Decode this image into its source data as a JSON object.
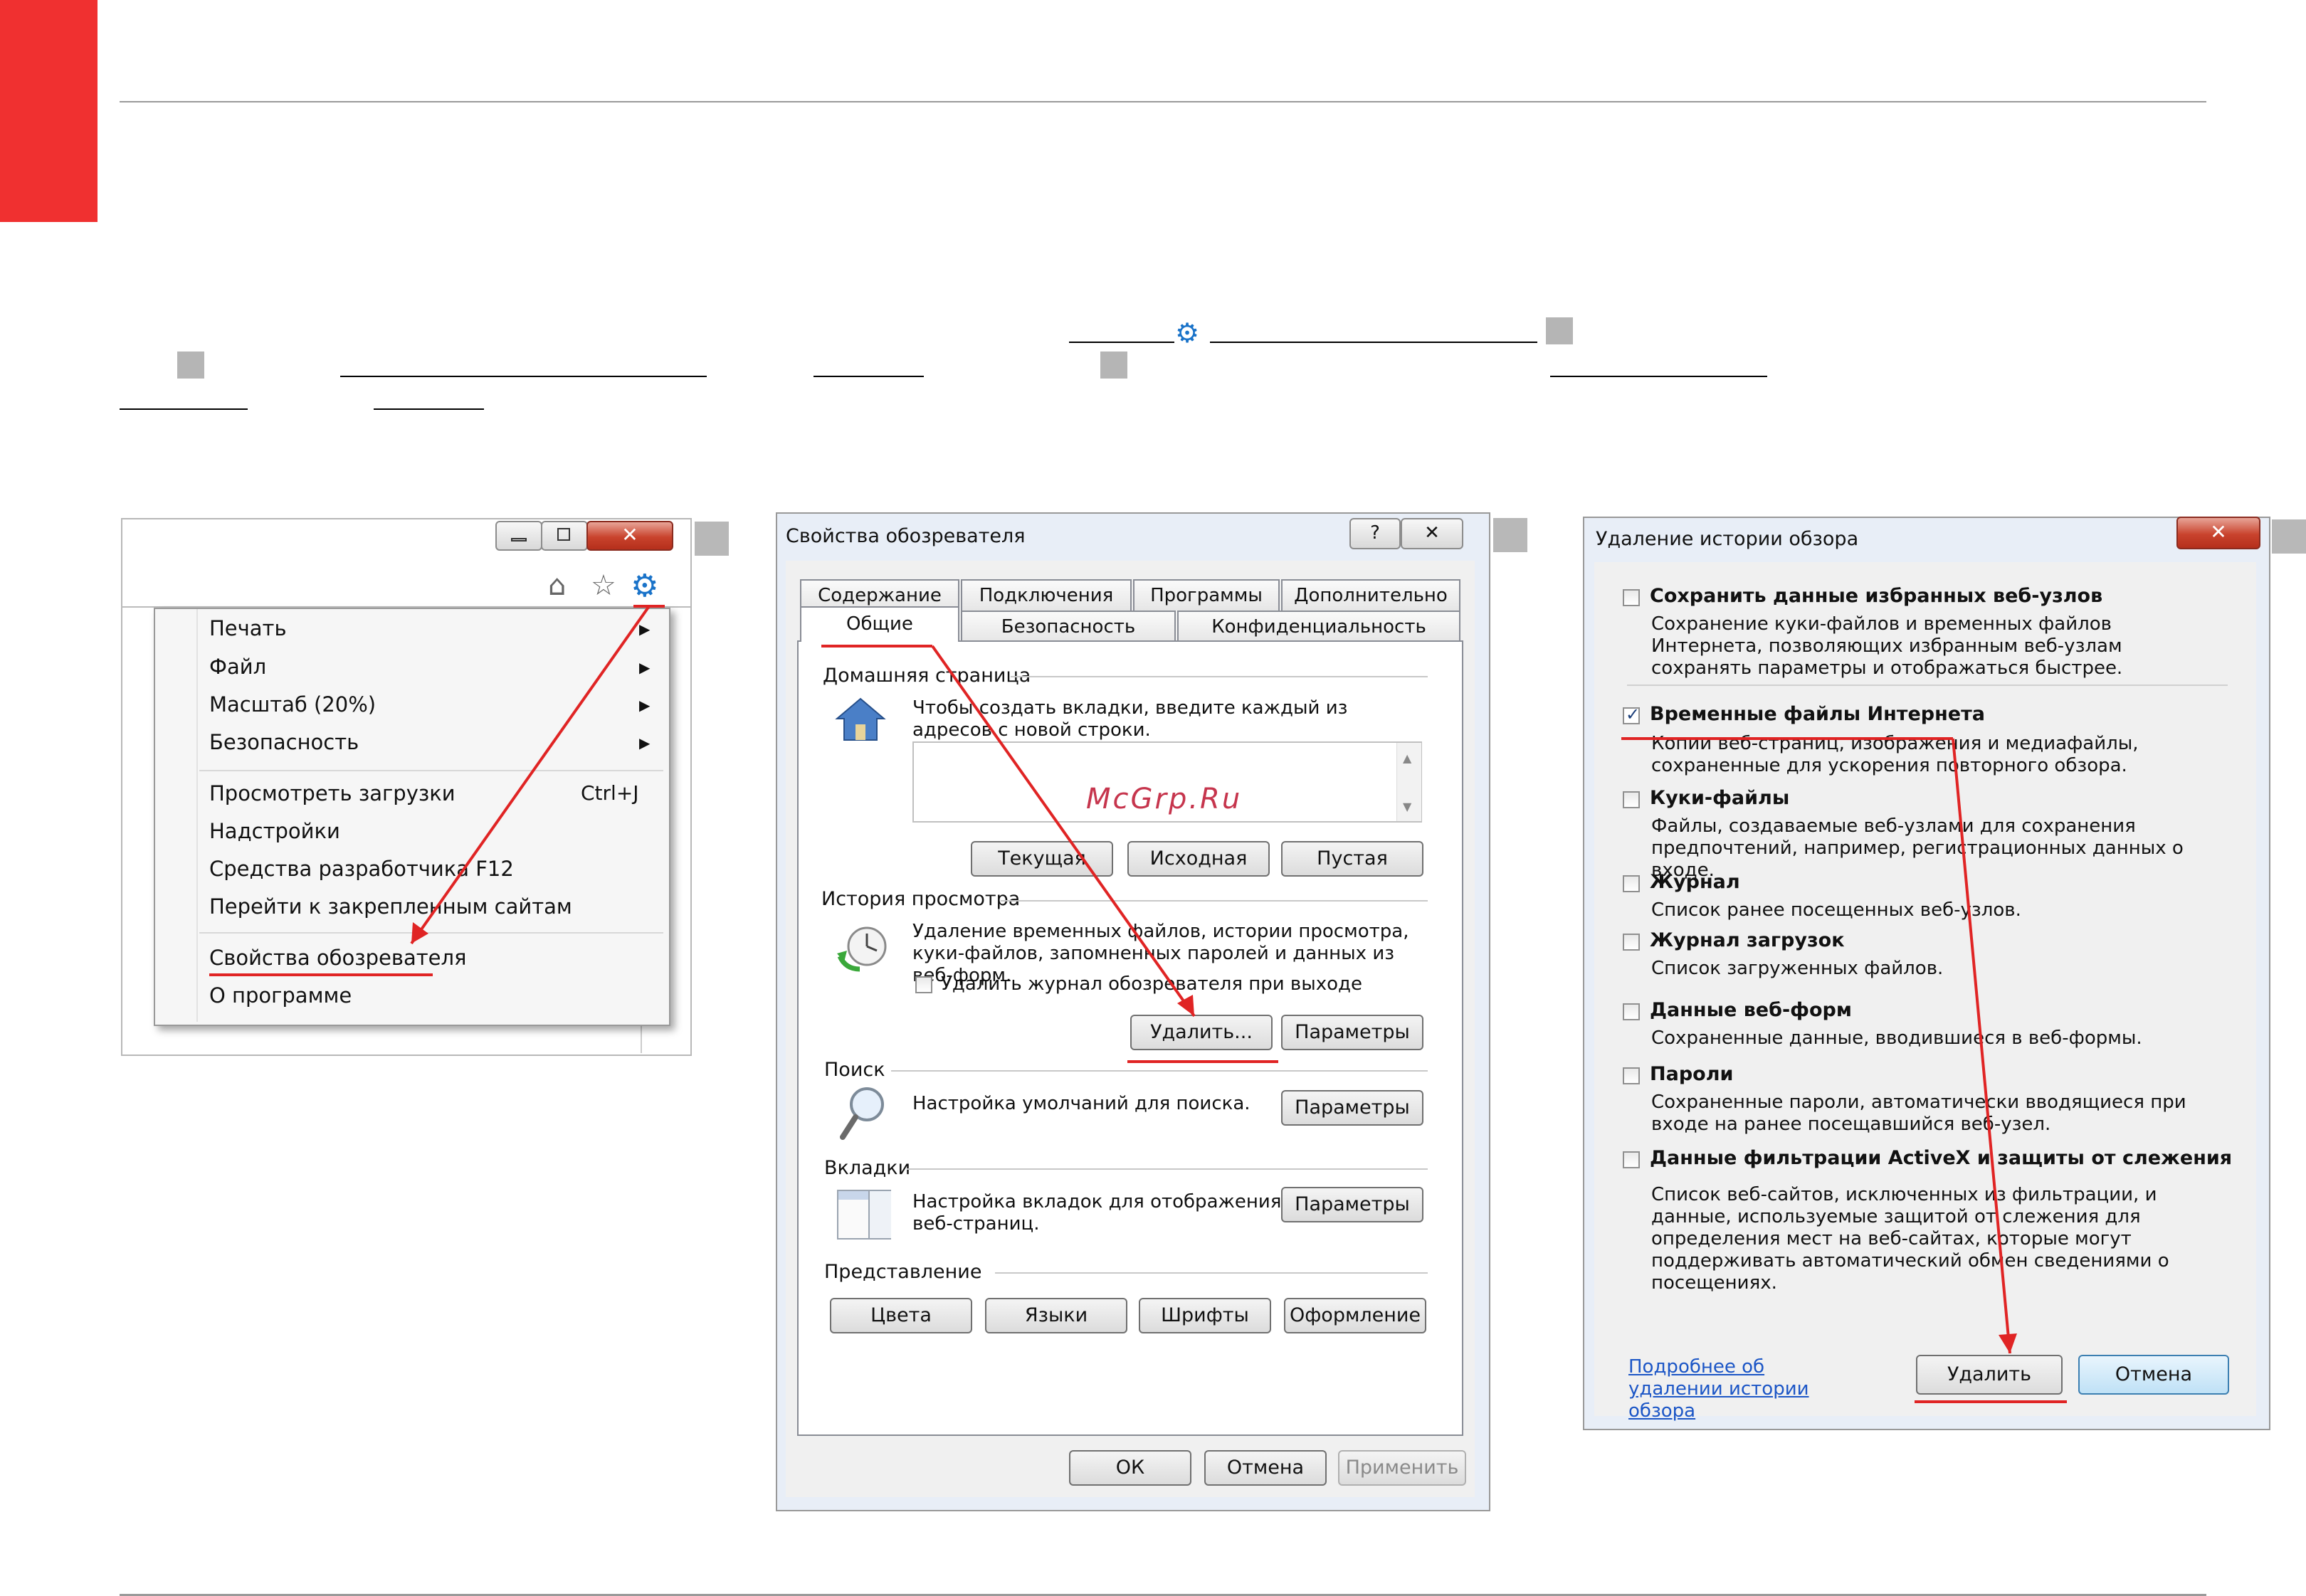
{
  "panel1": {
    "menu": {
      "items": [
        {
          "label": "Печать",
          "submenu": true
        },
        {
          "label": "Файл",
          "submenu": true
        },
        {
          "label": "Масштаб (20%)",
          "submenu": true
        },
        {
          "label": "Безопасность",
          "submenu": true
        },
        {
          "label": "Просмотреть загрузки",
          "shortcut": "Ctrl+J"
        },
        {
          "label": "Надстройки"
        },
        {
          "label": "Средства разработчика F12"
        },
        {
          "label": "Перейти к закрепленным сайтам"
        },
        {
          "label": "Свойства обозревателя"
        },
        {
          "label": "О программе"
        }
      ]
    },
    "icons": [
      "home-icon",
      "star-icon",
      "gear-icon"
    ]
  },
  "panel2": {
    "title": "Свойства обозревателя",
    "help": "?",
    "tabs_row1": [
      "Содержание",
      "Подключения",
      "Программы",
      "Дополнительно"
    ],
    "tabs_row2": [
      "Общие",
      "Безопасность",
      "Конфиденциальность"
    ],
    "home": {
      "label": "Домашняя страница",
      "text": "Чтобы создать вкладки, введите каждый из адресов с новой строки.",
      "btn_current": "Текущая",
      "btn_default": "Исходная",
      "btn_blank": "Пустая"
    },
    "watermark": "McGrp.Ru",
    "history": {
      "label": "История просмотра",
      "text": "Удаление временных файлов, истории просмотра, куки-файлов, запомненных паролей и данных из веб-форм.",
      "checkbox": "Удалить журнал обозревателя при выходе",
      "btn_delete": "Удалить...",
      "btn_params": "Параметры"
    },
    "search": {
      "label": "Поиск",
      "text": "Настройка умолчаний для поиска.",
      "btn": "Параметры"
    },
    "tabs_section": {
      "label": "Вкладки",
      "text": "Настройка вкладок для отображения веб-страниц.",
      "btn": "Параметры"
    },
    "appearance": {
      "label": "Представление",
      "btns": [
        "Цвета",
        "Языки",
        "Шрифты",
        "Оформление"
      ]
    },
    "footer": {
      "ok": "ОК",
      "cancel": "Отмена",
      "apply": "Применить"
    }
  },
  "panel3": {
    "title": "Удаление истории обзора",
    "items": [
      {
        "title": "Сохранить данные избранных веб-узлов",
        "desc": "Сохранение куки-файлов и временных файлов Интернета, позволяющих избранным веб-узлам сохранять параметры и отображаться быстрее.",
        "checked": false
      },
      {
        "title": "Временные файлы Интернета",
        "desc": "Копии веб-страниц, изображения и медиафайлы, сохраненные для ускорения повторного обзора.",
        "checked": true
      },
      {
        "title": "Куки-файлы",
        "desc": "Файлы, создаваемые веб-узлами для сохранения предпочтений, например, регистрационных данных о входе.",
        "checked": false
      },
      {
        "title": "Журнал",
        "desc": "Список ранее посещенных веб-узлов.",
        "checked": false
      },
      {
        "title": "Журнал загрузок",
        "desc": "Список загруженных файлов.",
        "checked": false
      },
      {
        "title": "Данные веб-форм",
        "desc": "Сохраненные данные, вводившиеся в веб-формы.",
        "checked": false
      },
      {
        "title": "Пароли",
        "desc": "Сохраненные пароли, автоматически вводящиеся при входе на ранее посещавшийся веб-узел.",
        "checked": false
      },
      {
        "title": "Данные фильтрации ActiveX и защиты от слежения",
        "desc": "Список веб-сайтов, исключенных из фильтрации, и данные, используемые защитой от слежения для определения мест на веб-сайтах, которые могут поддерживать автоматический обмен сведениями о посещениях.",
        "checked": false
      }
    ],
    "link": "Подробнее об удалении истории обзора",
    "btn_delete": "Удалить",
    "btn_cancel": "Отмена"
  }
}
